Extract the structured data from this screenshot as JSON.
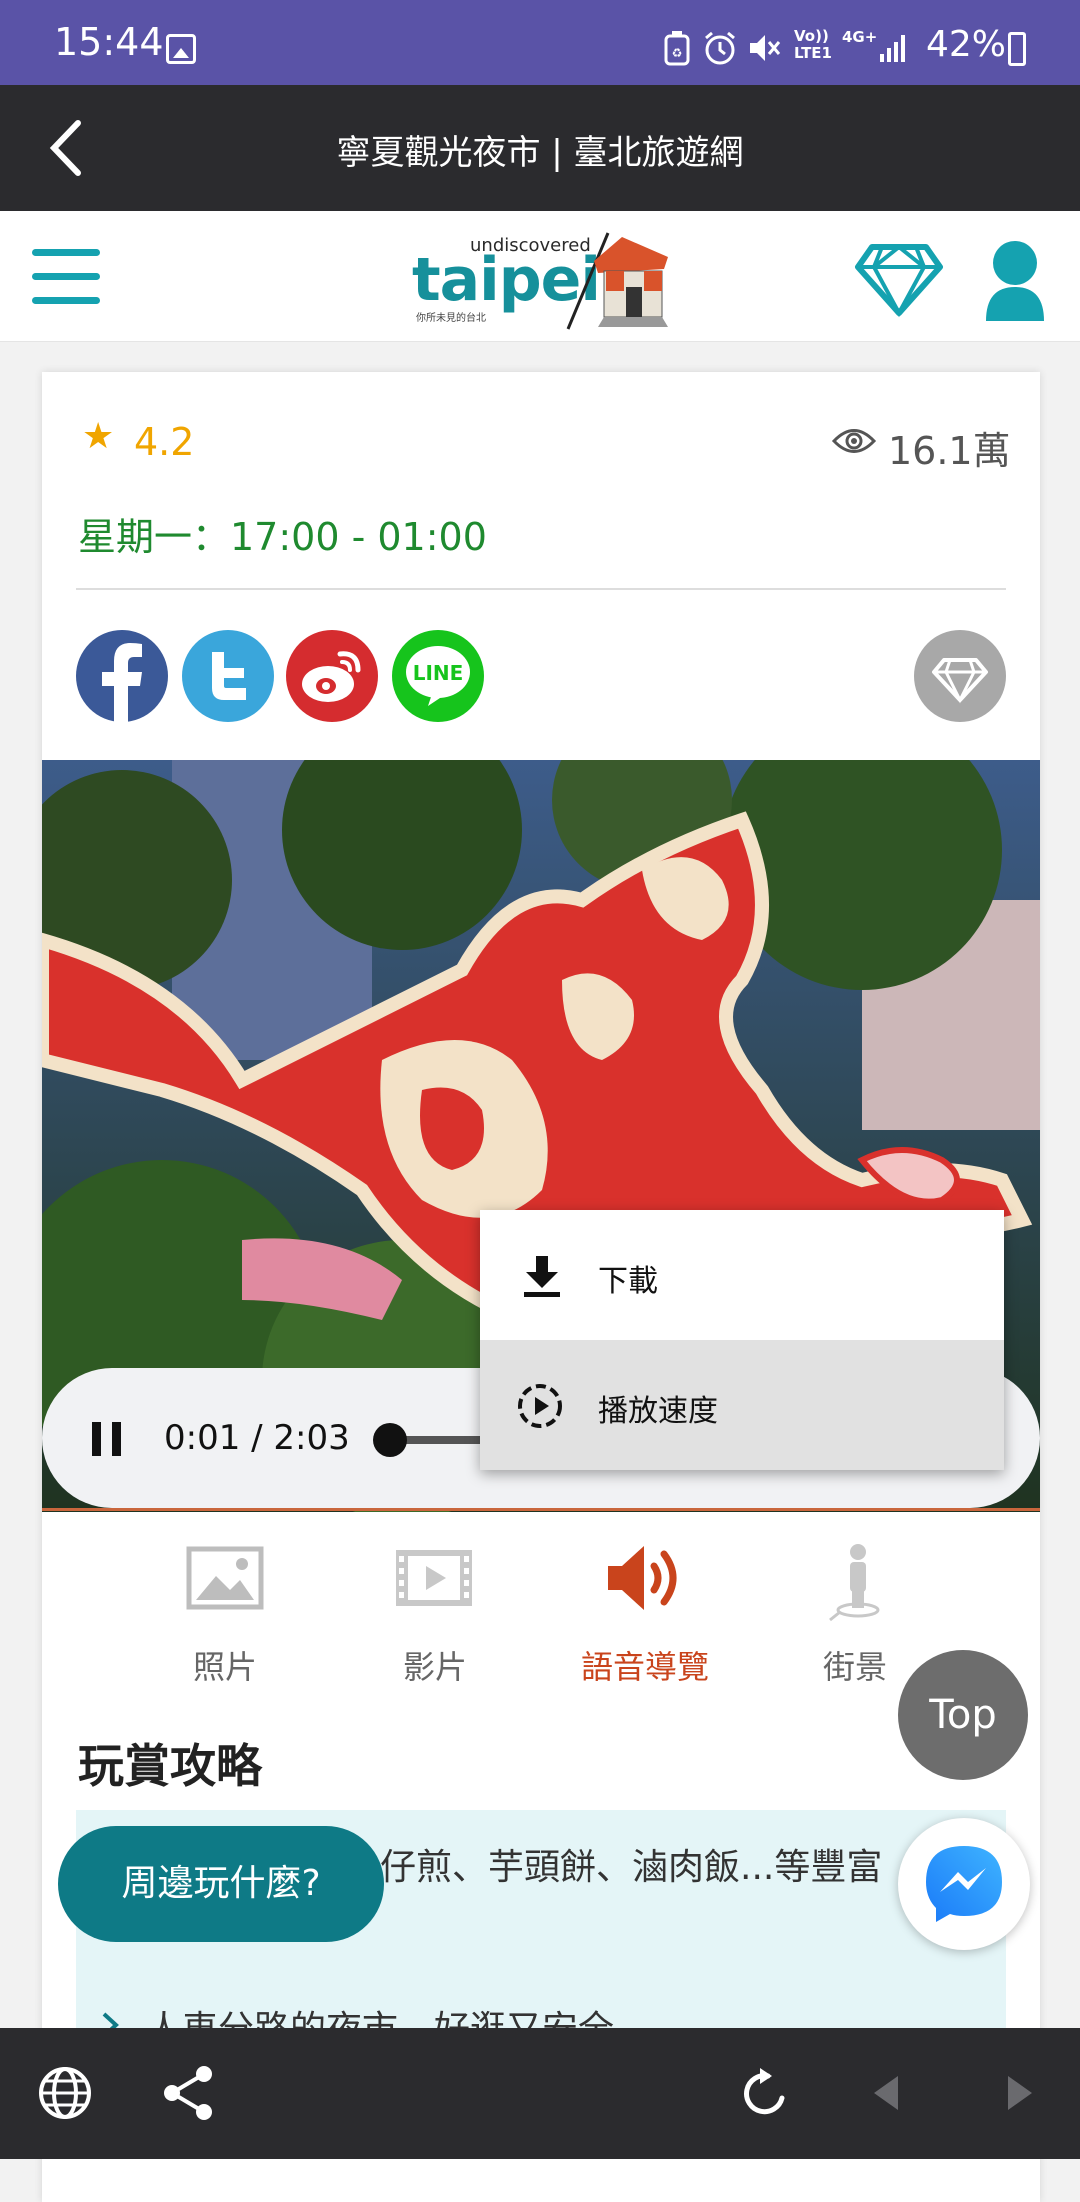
{
  "status_bar": {
    "time": "15:44",
    "network_volte": "Vo)) LTE1",
    "network_4g": "4G+",
    "battery": "42%"
  },
  "header": {
    "title": "寧夏觀光夜市 | 臺北旅遊網"
  },
  "logo": {
    "brand_top": "undiscovered",
    "brand_main": "taipei",
    "brand_sub": "你所未見的台北"
  },
  "card": {
    "rating": "4.2",
    "views": "16.1萬",
    "hours": "星期一：17:00 - 01:00",
    "social": {
      "line_label": "LINE"
    }
  },
  "audio": {
    "time": "0:01 / 2:03",
    "progress": 0.008
  },
  "audio_menu": {
    "download": "下載",
    "playback_speed": "播放速度"
  },
  "media_tabs": {
    "photos": "照片",
    "videos": "影片",
    "audio": "語音導覽",
    "streetview": "街景"
  },
  "guide": {
    "heading": "玩賞攻略",
    "line1": "仔煎、芋頭餅、滷肉飯...等豐富",
    "line2": "人車分路的夜市，好逛又安全"
  },
  "floating": {
    "nearby": "周邊玩什麼?",
    "top": "Top"
  },
  "colors": {
    "status_bar": "#5a53a7",
    "header": "#2b2b2e",
    "brand_teal": "#15a2b0",
    "rating": "#f0a500",
    "hours_green": "#1f8a2f",
    "audio_active": "#c9441c"
  }
}
